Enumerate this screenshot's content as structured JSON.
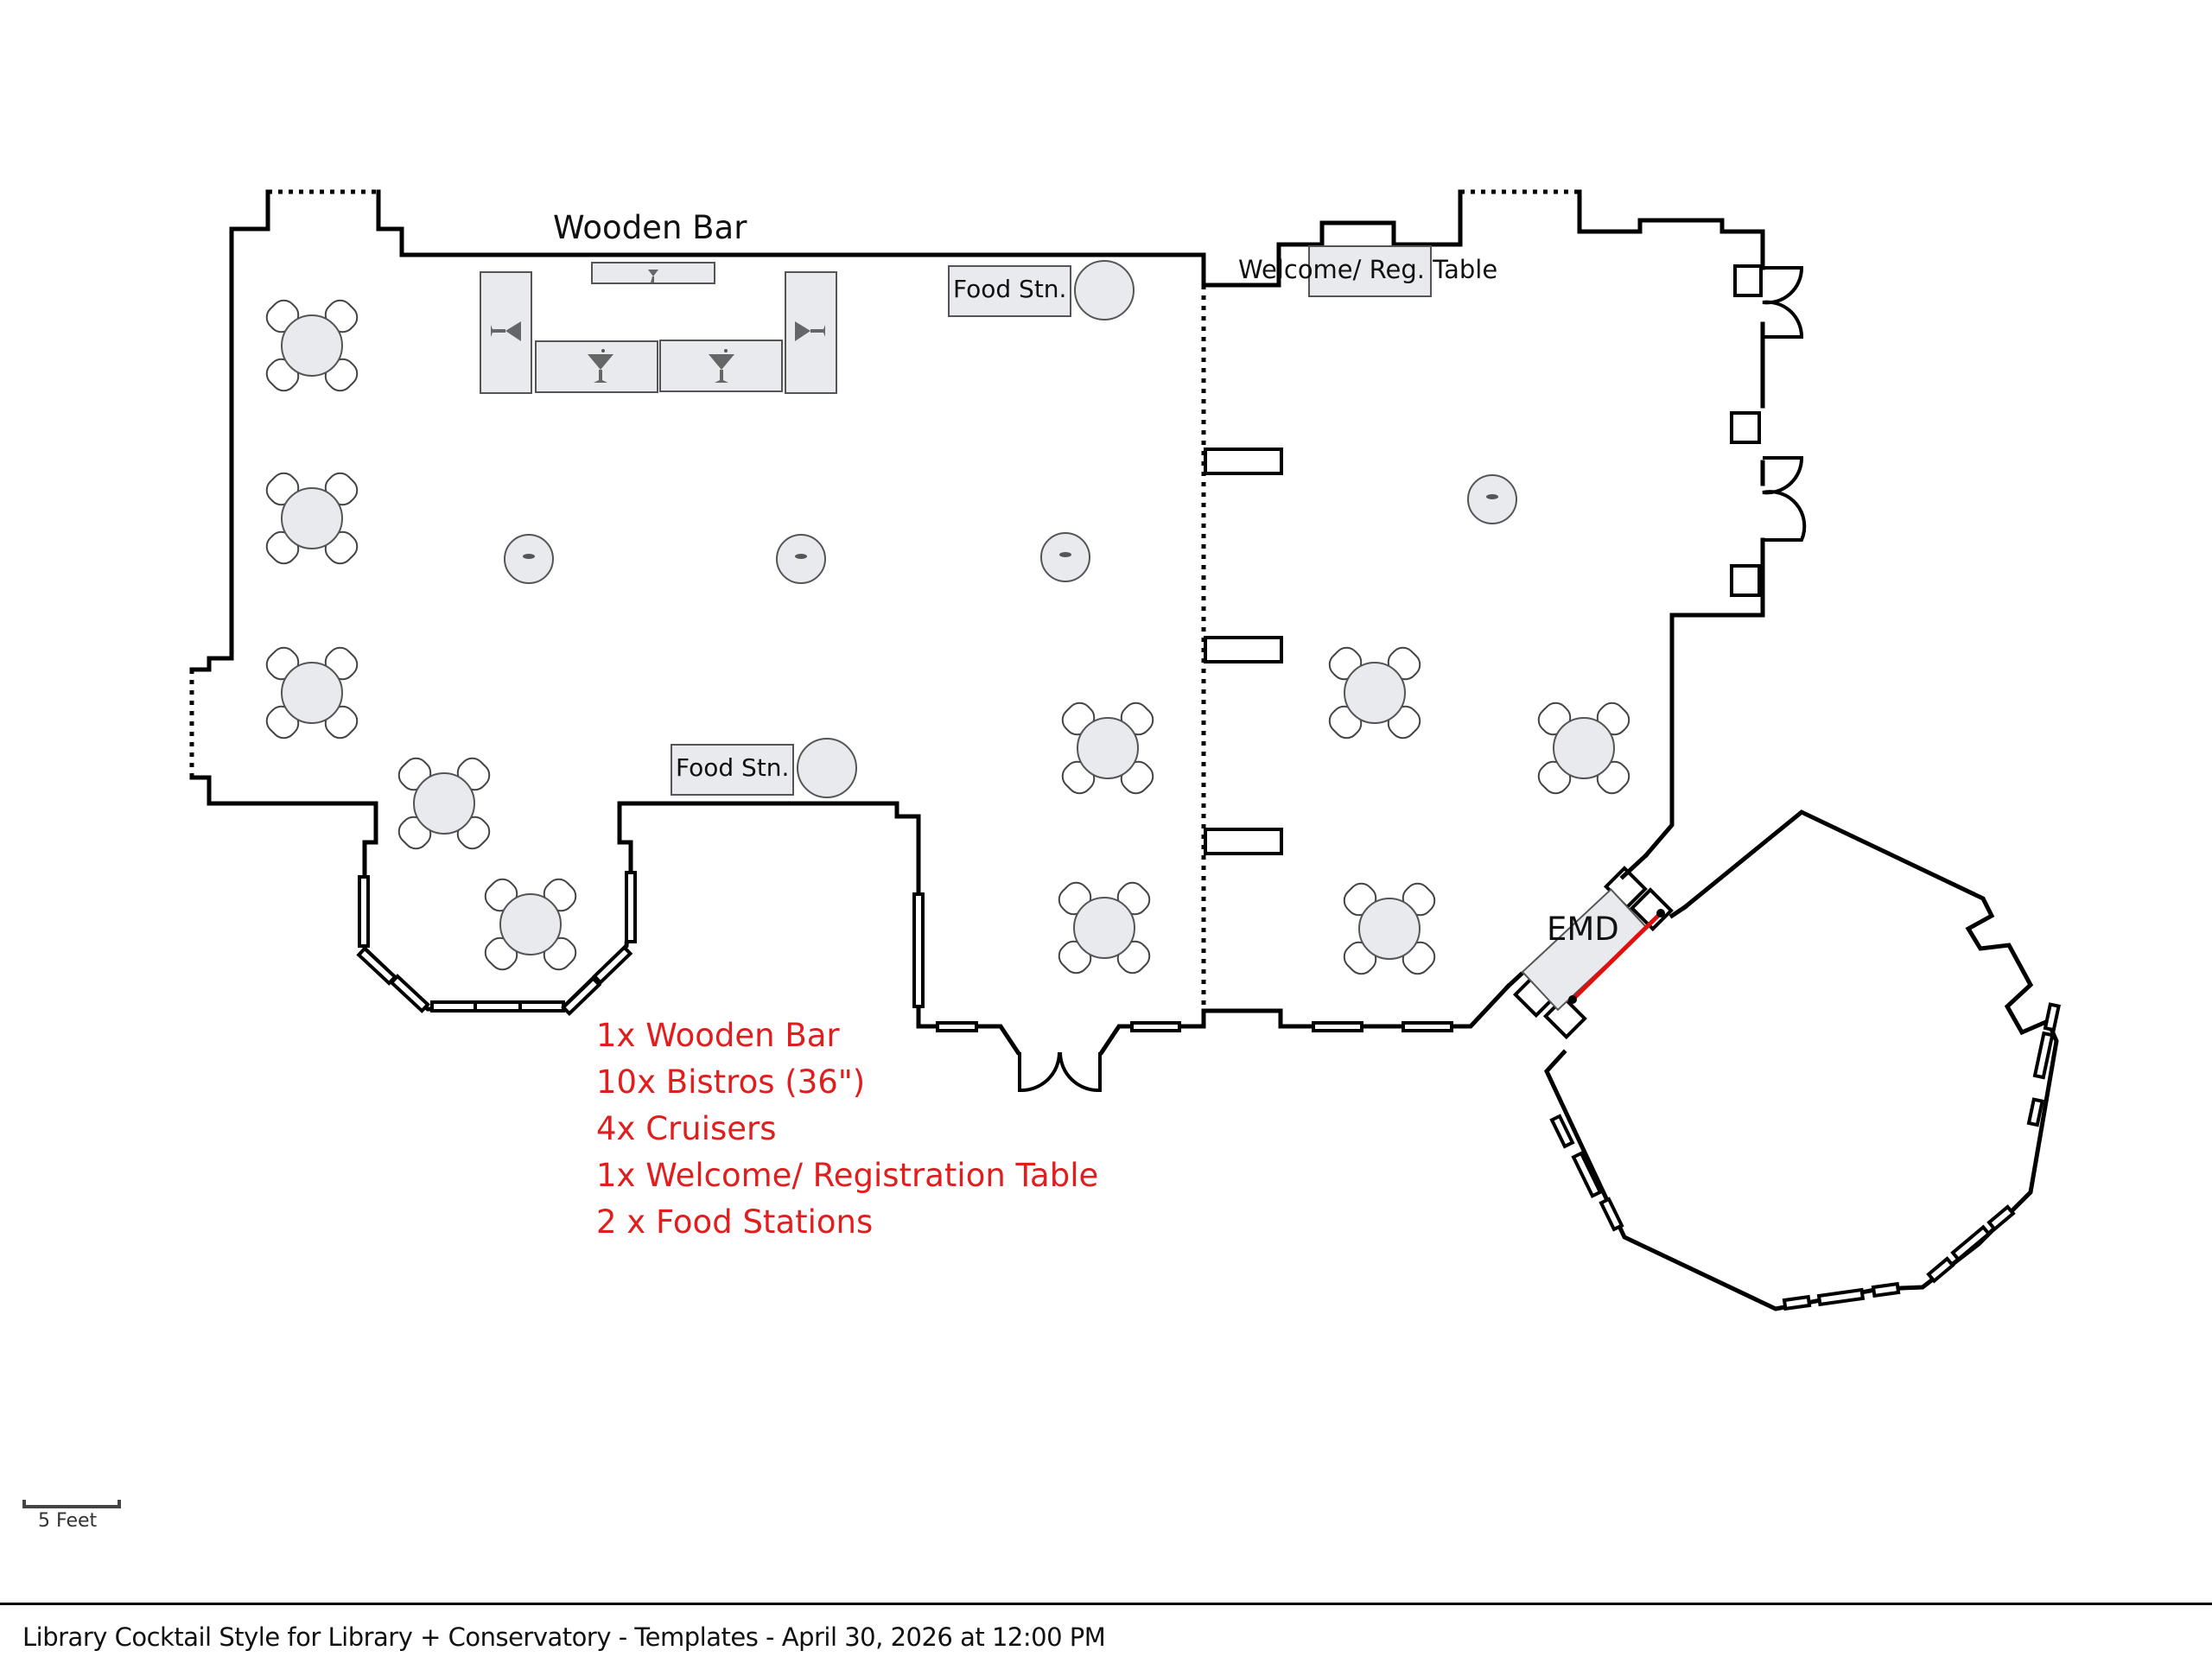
{
  "labels": {
    "wooden_bar": "Wooden Bar",
    "food_station_1": "Food Stn.",
    "food_station_2": "Food Stn.",
    "welcome_table": "Welcome/ Reg. Table",
    "emd": "EMD"
  },
  "inventory": [
    "1x Wooden Bar",
    "10x Bistros (36\")",
    "4x Cruisers",
    "1x Welcome/ Registration Table",
    "2 x Food Stations"
  ],
  "scale": {
    "label": "5 Feet"
  },
  "footer": {
    "text": "Library Cocktail Style for Library + Conservatory - Templates - April 30, 2026 at 12:00 PM"
  },
  "colors": {
    "accent_red": "#e01e1e",
    "furniture_fill": "#e8eaed",
    "wall": "#000000"
  },
  "furniture_counts": {
    "bistro_tables": 10,
    "cruiser_tables": 4,
    "food_stations": 2,
    "bar_sections": 5
  }
}
